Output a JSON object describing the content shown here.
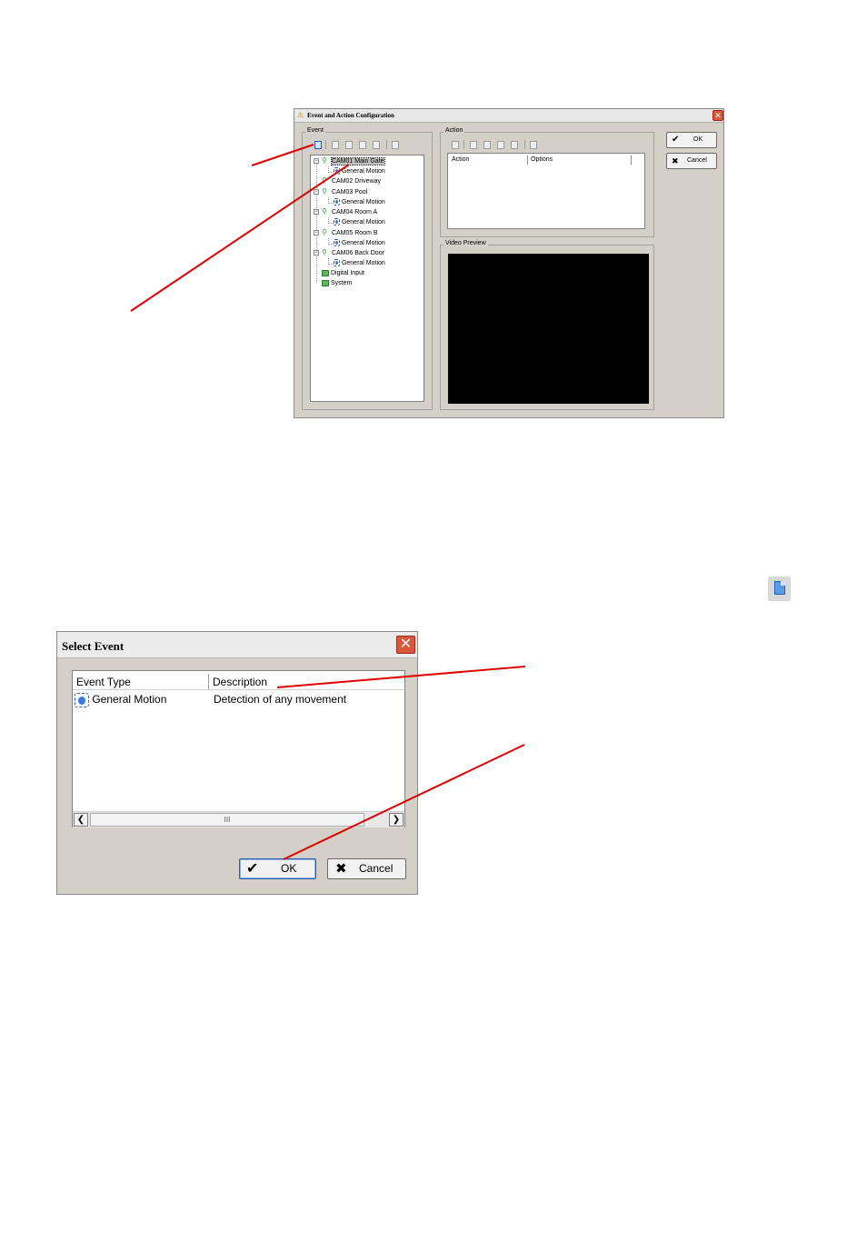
{
  "config_dialog": {
    "title": "Event and Action Configuration",
    "close_glyph": "✕",
    "event_group_label": "Event",
    "tree": [
      {
        "label": "CAM01 Main Gate",
        "child": "General Motion"
      },
      {
        "label": "CAM02 Driveway"
      },
      {
        "label": "CAM03 Pool",
        "child": "General Motion"
      },
      {
        "label": "CAM04 Room A",
        "child": "General Motion"
      },
      {
        "label": "CAM05 Room B",
        "child": "General Motion"
      },
      {
        "label": "CAM06 Back Door",
        "child": "General Motion"
      },
      {
        "label": "Digital Input"
      },
      {
        "label": "System"
      }
    ],
    "action_group_label": "Action",
    "action_columns": [
      "Action",
      "Options"
    ],
    "video_preview_label": "Video Preview",
    "ok_label": "OK",
    "cancel_label": "Cancel",
    "check_glyph": "✔",
    "x_glyph": "✖",
    "expander_glyph": "−"
  },
  "select_event_dialog": {
    "title": "Select Event",
    "close_glyph": "✕",
    "columns": [
      "Event Type",
      "Description"
    ],
    "rows": [
      {
        "event_type": "General Motion",
        "description": "Detection of any movement"
      }
    ],
    "scroll_left": "❮",
    "scroll_right": "❯",
    "scroll_thumb": "III",
    "ok_label": "OK",
    "cancel_label": "Cancel",
    "check_glyph": "✔",
    "x_glyph": "✖"
  },
  "colors": {
    "dialog_bg": "#d4d0c8",
    "annotation_red": "#e00000",
    "close_red": "#d9573f",
    "camera_green": "#2e9a2e"
  }
}
